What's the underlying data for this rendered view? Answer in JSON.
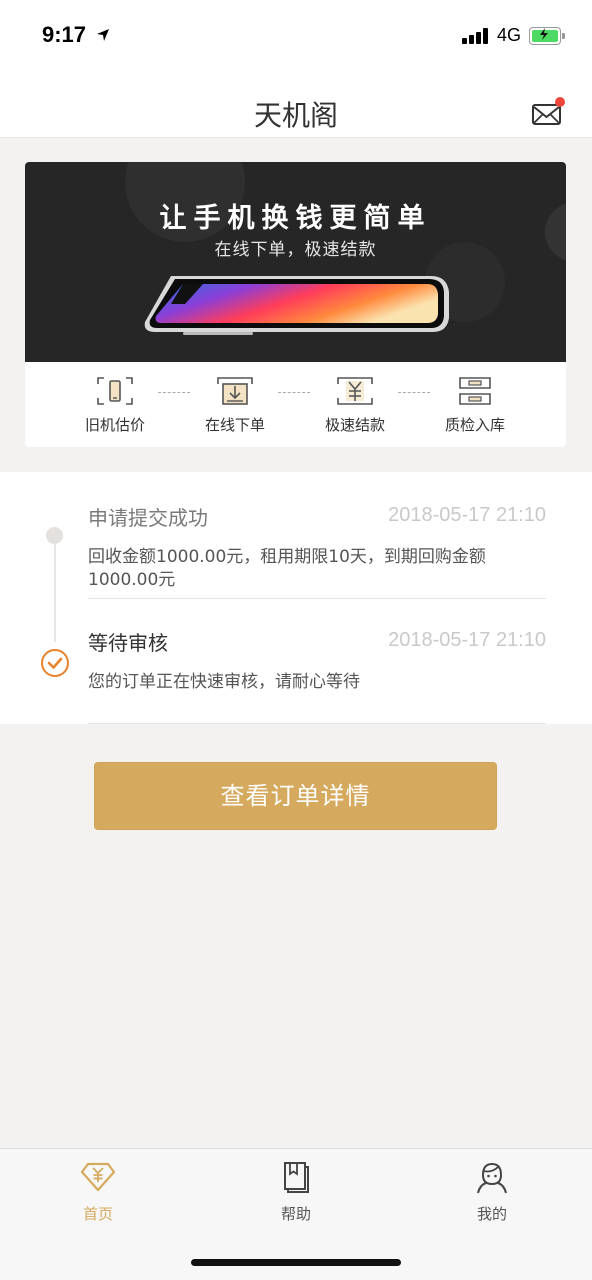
{
  "status_bar": {
    "time": "9:17",
    "network": "4G"
  },
  "nav": {
    "title": "天机阁"
  },
  "banner": {
    "title": "让手机换钱更简单",
    "subtitle": "在线下单，极速结款"
  },
  "steps": [
    {
      "label": "旧机估价",
      "icon": "phone-price-icon"
    },
    {
      "label": "在线下单",
      "icon": "download-order-icon"
    },
    {
      "label": "极速结款",
      "icon": "yuan-payment-icon"
    },
    {
      "label": "质检入库",
      "icon": "inspection-storage-icon"
    }
  ],
  "timeline": [
    {
      "title": "申请提交成功",
      "time": "2018-05-17 21:10",
      "desc": "回收金额1000.00元，租用期限10天，到期回购金额1000.00元",
      "state": "done"
    },
    {
      "title": "等待审核",
      "time": "2018-05-17 21:10",
      "desc": "您的订单正在快速审核，请耐心等待",
      "state": "current"
    }
  ],
  "action_button": {
    "label": "查看订单详情"
  },
  "tabbar": {
    "items": [
      {
        "label": "首页",
        "icon": "diamond-yuan-icon",
        "active": true
      },
      {
        "label": "帮助",
        "icon": "book-icon",
        "active": false
      },
      {
        "label": "我的",
        "icon": "person-icon",
        "active": false
      }
    ]
  },
  "colors": {
    "accent": "#d6aa5e",
    "check": "#e8822d",
    "badge": "#f0463c"
  }
}
